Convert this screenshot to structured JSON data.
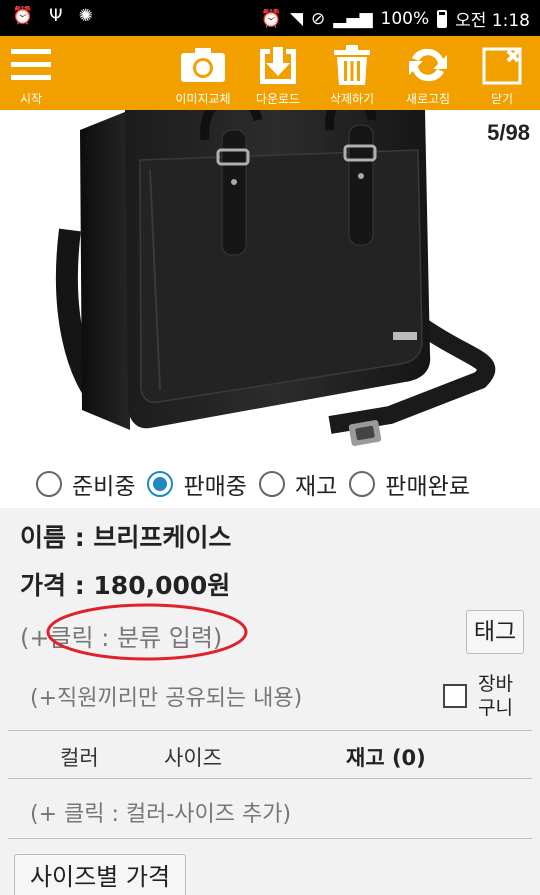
{
  "status_bar": {
    "battery": "100%",
    "clock": "오전 1:18"
  },
  "toolbar": {
    "menu_label": "시작",
    "change_image_label": "이미지교체",
    "download_label": "다운로드",
    "delete_label": "삭제하기",
    "refresh_label": "새로고침",
    "close_label": "닫기",
    "accent_color": "#f2a000"
  },
  "viewer": {
    "counter": "5/98"
  },
  "sale_status": {
    "options": [
      "준비중",
      "판매중",
      "재고",
      "판매완료"
    ],
    "selected": "판매중"
  },
  "product": {
    "name_line": "이름 : 브리프케이스",
    "price_line": "가격 : 180,000원",
    "category_hint": "(+클릭 : 분류 입력)",
    "tag_button": "태그",
    "staff_note_hint": "(+직원끼리만 공유되는 내용)",
    "cart_label_1": "장바",
    "cart_label_2": "구니"
  },
  "stock_table": {
    "col_color": "컬러",
    "col_size": "사이즈",
    "col_stock": "재고 (0)",
    "add_hint": "(+ 클릭 : 컬러-사이즈 추가)"
  },
  "size_price_button": "사이즈별 가격"
}
